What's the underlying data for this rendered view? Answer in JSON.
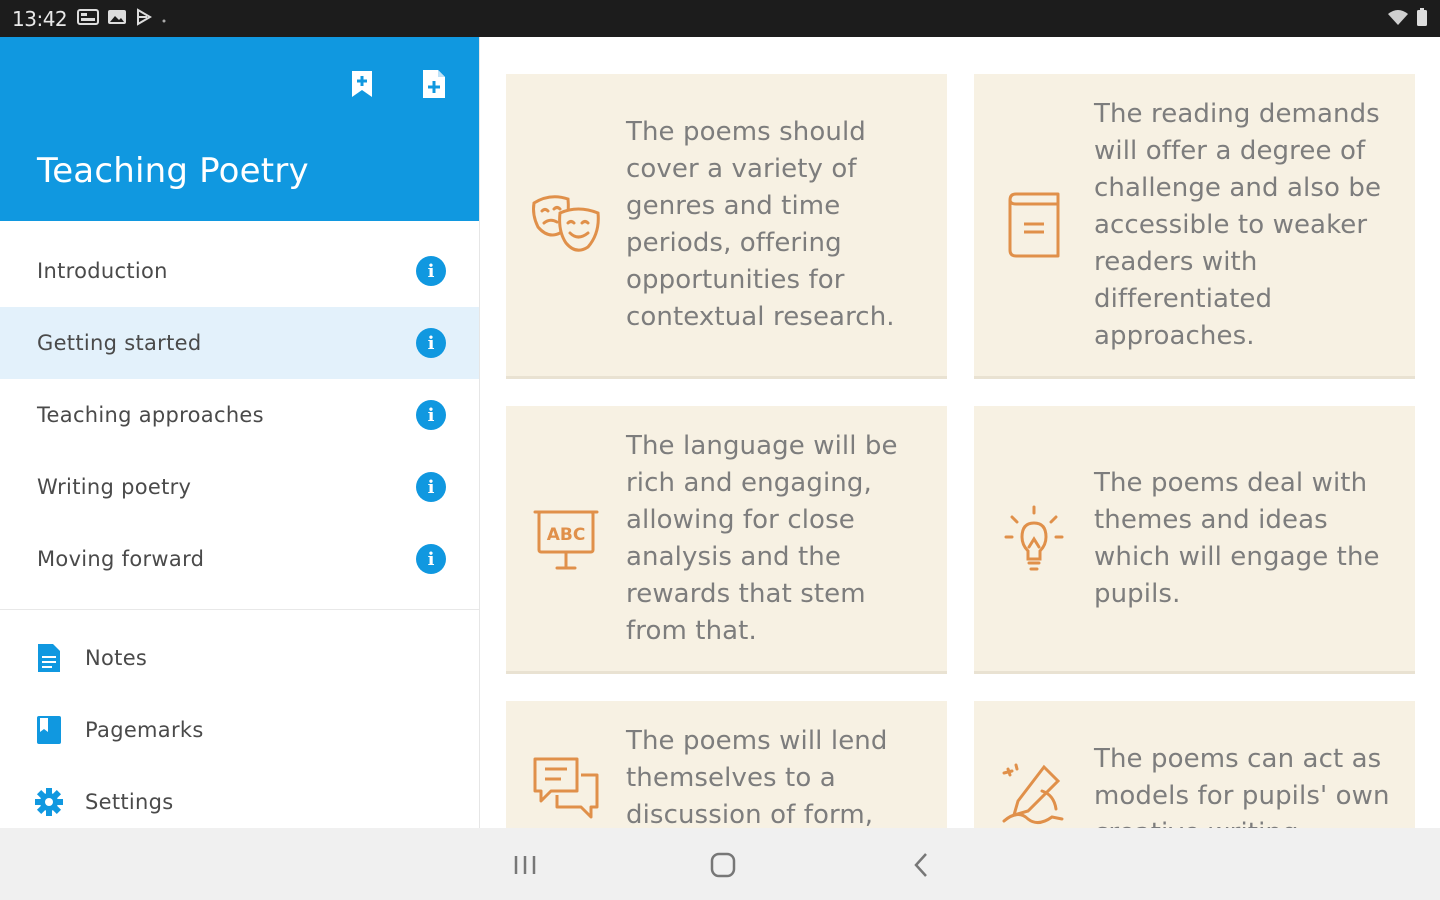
{
  "status_bar": {
    "time": "13:42"
  },
  "drawer": {
    "title": "Teaching Poetry",
    "header_actions": [
      {
        "icon": "bookmark-icon"
      },
      {
        "icon": "add-note-icon"
      }
    ],
    "menu": [
      {
        "label": "Introduction",
        "active": false
      },
      {
        "label": "Getting started",
        "active": true
      },
      {
        "label": "Teaching approaches",
        "active": false
      },
      {
        "label": "Writing poetry",
        "active": false
      },
      {
        "label": "Moving forward",
        "active": false
      }
    ],
    "tools": [
      {
        "label": "Notes",
        "icon": "notes-icon"
      },
      {
        "label": "Pagemarks",
        "icon": "pagemarks-icon"
      },
      {
        "label": "Settings",
        "icon": "gear-icon"
      }
    ]
  },
  "cards": [
    {
      "icon": "theatre-masks-icon",
      "text": "The poems should cover a variety of genres and time periods, offering opportunities for contextual research."
    },
    {
      "icon": "book-icon",
      "text": "The reading demands will offer a degree of challenge and also be accessible to weaker readers with differentiated approaches."
    },
    {
      "icon": "abc-board-icon",
      "text": "The language will be rich and engaging, allowing for close analysis and the rewards that stem from that."
    },
    {
      "icon": "lightbulb-icon",
      "text": "The poems deal with themes and ideas which will engage the pupils."
    },
    {
      "icon": "speech-bubbles-icon",
      "text": "The poems will lend themselves to a discussion of form,"
    },
    {
      "icon": "writing-hand-icon",
      "text": "The poems can act as models for pupils' own creative writing."
    }
  ],
  "colors": {
    "accent": "#1098e0",
    "card_bg": "#f7f1e3",
    "icon_orange": "#e0904a"
  }
}
